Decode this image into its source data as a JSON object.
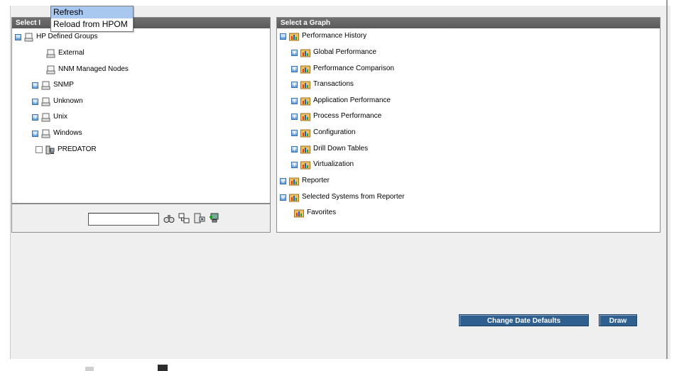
{
  "context_menu": {
    "items": [
      "Refresh",
      "Reload from HPOM"
    ]
  },
  "left_panel": {
    "header": "Select I",
    "tree": [
      {
        "label": "HP Defined Groups",
        "expander": "−",
        "icon": "group-icon"
      },
      {
        "label": "External",
        "icon": "group-icon"
      },
      {
        "label": "NNM Managed Nodes",
        "icon": "group-icon"
      },
      {
        "label": "SNMP",
        "expander": "+",
        "icon": "group-icon"
      },
      {
        "label": "Unknown",
        "expander": "+",
        "icon": "group-icon"
      },
      {
        "label": "Unix",
        "expander": "+",
        "icon": "group-icon"
      },
      {
        "label": "Windows",
        "expander": "+",
        "icon": "group-icon"
      },
      {
        "label": "PREDATOR",
        "checkbox": true,
        "icon": "system-icon"
      }
    ],
    "search_value": ""
  },
  "right_panel": {
    "header": "Select a Graph",
    "tree": [
      {
        "label": "Performance History",
        "expander": "−"
      },
      {
        "label": "Global Performance",
        "expander": "+"
      },
      {
        "label": "Performance Comparison",
        "expander": "+"
      },
      {
        "label": "Transactions",
        "expander": "+"
      },
      {
        "label": "Application Performance",
        "expander": "+"
      },
      {
        "label": "Process Performance",
        "expander": "+"
      },
      {
        "label": "Configuration",
        "expander": "+"
      },
      {
        "label": "Drill Down Tables",
        "expander": "+"
      },
      {
        "label": "Virtualization",
        "expander": "+"
      },
      {
        "label": "Reporter",
        "expander": "+"
      },
      {
        "label": "Selected Systems from Reporter",
        "expander": "+"
      },
      {
        "label": "Favorites"
      }
    ]
  },
  "buttons": {
    "change_date_defaults": "Change Date Defaults",
    "draw": "Draw"
  },
  "colors": {
    "header_bg": "#5a5a5a",
    "button_bg": "#2e5f8f",
    "menu_highlight": "#a8c8f0"
  }
}
